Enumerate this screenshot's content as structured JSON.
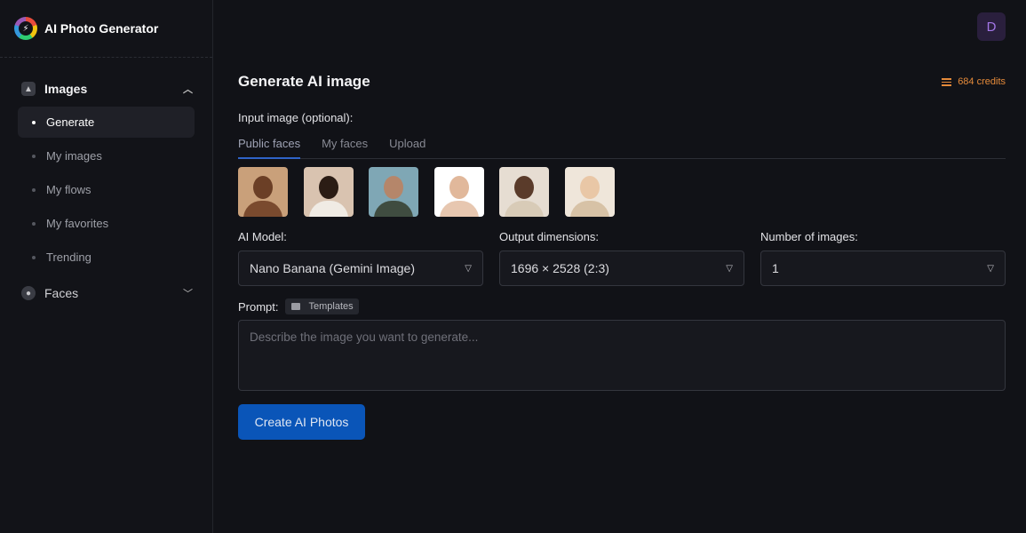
{
  "brand": {
    "name": "AI Photo Generator"
  },
  "sidebar": {
    "groups": [
      {
        "label": "Images",
        "expanded": true
      },
      {
        "label": "Faces",
        "expanded": false
      }
    ],
    "items": [
      {
        "label": "Generate",
        "active": true
      },
      {
        "label": "My images"
      },
      {
        "label": "My flows"
      },
      {
        "label": "My favorites"
      },
      {
        "label": "Trending"
      }
    ]
  },
  "user": {
    "avatar_initial": "D"
  },
  "main": {
    "title": "Generate AI image",
    "credits": "684 credits",
    "input_label": "Input image (optional):",
    "tabs": [
      {
        "label": "Public faces",
        "active": true
      },
      {
        "label": "My faces"
      },
      {
        "label": "Upload"
      }
    ],
    "model": {
      "label": "AI Model:",
      "value": "Nano Banana (Gemini Image)"
    },
    "dimensions": {
      "label": "Output dimensions:",
      "value": "1696 × 2528 (2:3)"
    },
    "count": {
      "label": "Number of images:",
      "value": "1"
    },
    "prompt": {
      "label": "Prompt:",
      "templates_label": "Templates",
      "placeholder": "Describe the image you want to generate..."
    },
    "create_button": "Create AI Photos"
  },
  "colors": {
    "accent": "#0a55b8",
    "tab_underline": "#2f63c8",
    "credits": "#e58a3a",
    "avatar_bg": "#2a1f3d",
    "avatar_text": "#a477e8"
  }
}
